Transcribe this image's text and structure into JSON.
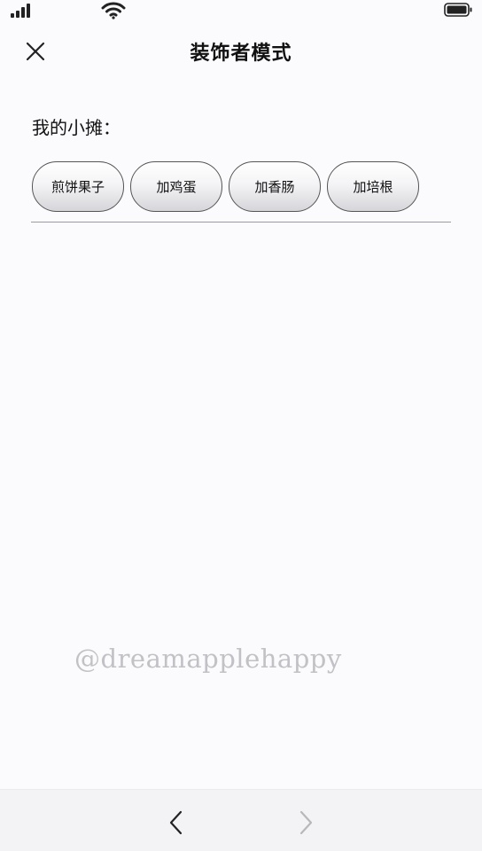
{
  "status_bar": {
    "signal_icon": "cellular-signal-icon",
    "wifi_icon": "wifi-icon",
    "battery_icon": "battery-icon"
  },
  "nav": {
    "close_icon": "close-icon",
    "title": "装饰者模式"
  },
  "main": {
    "section_label": "我的小摊：",
    "buttons": [
      {
        "label": "煎饼果子"
      },
      {
        "label": "加鸡蛋"
      },
      {
        "label": "加香肠"
      },
      {
        "label": "加培根"
      }
    ]
  },
  "watermark": "@dreamapplehappy",
  "bottom_bar": {
    "back_icon": "chevron-left-icon",
    "forward_icon": "chevron-right-icon"
  },
  "colors": {
    "background": "#fbfbfd",
    "button_border": "#555555",
    "divider": "#9a9aa2",
    "watermark": "#c2c2c6",
    "toolbar": "#f3f3f5",
    "forward_disabled": "#b8b8bc"
  }
}
